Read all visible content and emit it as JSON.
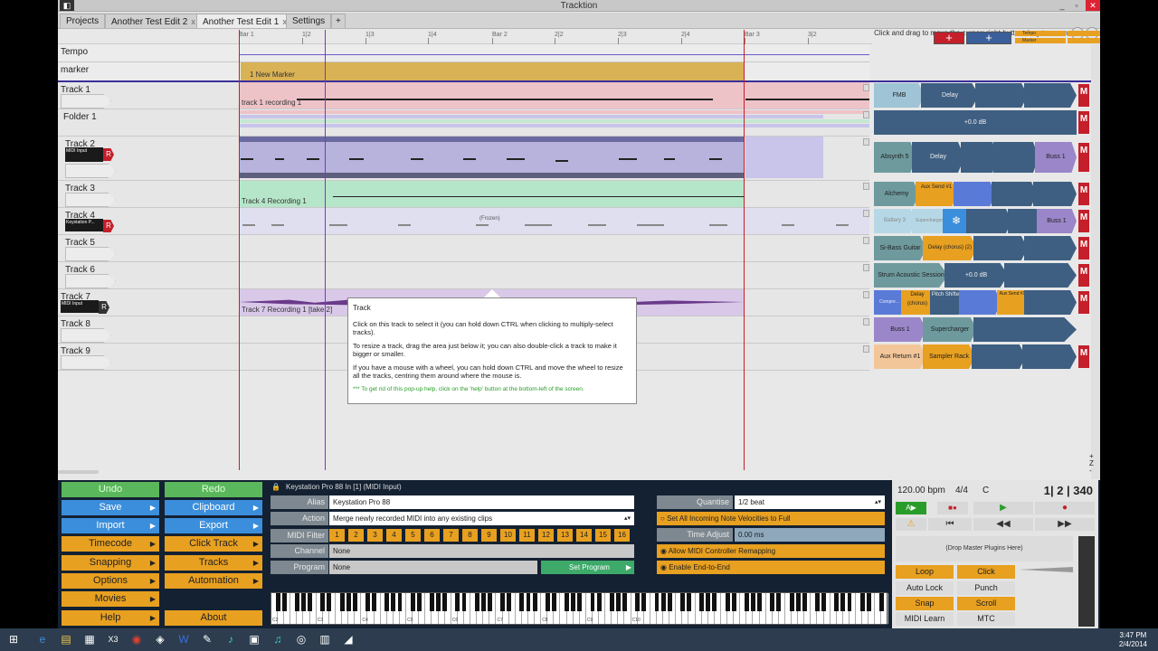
{
  "window": {
    "title": "Tracktion",
    "minimize": "_",
    "maximize": "▫",
    "close": "✕"
  },
  "tabs": [
    {
      "label": "Projects"
    },
    {
      "label": "Another Test Edit 2",
      "close": "x"
    },
    {
      "label": "Another Test Edit 1",
      "close": "x"
    },
    {
      "label": "Settings"
    },
    {
      "label": "+"
    }
  ],
  "hint": "Click and drag to move the cursor; right-button-drag to zoom",
  "ruler": {
    "labels": [
      "Bar 1",
      "1|2",
      "1|3",
      "1|4",
      "Bar 2",
      "2|2",
      "2|3",
      "2|4",
      "Bar 3",
      "3|2"
    ]
  },
  "corner": {
    "add_red": "+",
    "add_blue": "+",
    "tempo_label": "Tempo",
    "marker_label": "Marker"
  },
  "rows": {
    "tempo": "Tempo",
    "marker": "marker",
    "marker_clip": "1 New Marker"
  },
  "tracks": [
    {
      "name": "Track 1",
      "clip": "track 1 recording 1"
    },
    {
      "name": "Folder 1",
      "clip": ""
    },
    {
      "name": "Track 2",
      "midi_in": "MIDI Input",
      "rec": "R"
    },
    {
      "name": "Track 3",
      "clip": "Track 4 Recording 1"
    },
    {
      "name": "Track 4",
      "midi_in": "Keystation P...",
      "rec": "R",
      "clip": "(Frozen)"
    },
    {
      "name": "Track 5"
    },
    {
      "name": "Track 6"
    },
    {
      "name": "Track 7",
      "midi_in": "MIDI Input",
      "rec": "R",
      "clip": "Track 7 Recording 1 [take 2]"
    },
    {
      "name": "Track 8"
    },
    {
      "name": "Track 9"
    }
  ],
  "racks": [
    [
      "FMB",
      "Delay"
    ],
    [
      "+0.0 dB"
    ],
    [
      "Absynth 5",
      "Delay",
      "Buss 1"
    ],
    [
      "Alchemy",
      "Aux Send #1"
    ],
    [
      "Battery 3",
      "Supercharger",
      "Buss 1"
    ],
    [
      "Si-Bass Guitar",
      "Delay (chorus) (2)"
    ],
    [
      "Strum Acoustic Session",
      "+0.0 dB"
    ],
    [
      "Compre...",
      "Delay (chorus)",
      "Pitch Shifter",
      "Aux Send #1"
    ],
    [
      "Buss 1",
      "Supercharger"
    ],
    [
      "Aux Return #1",
      "Sampler Rack"
    ]
  ],
  "m_label": "M",
  "popup": {
    "title": "Track",
    "p1": "Click on this track to select it (you can hold down CTRL when clicking to multiply-select tracks).",
    "p2": "To resize a track, drag the area just below it; you can also double-click a track to make it bigger or smaller.",
    "p3": "If you have a mouse with a wheel, you can hold down CTRL and move the wheel to resize all the tracks, centring them around where the mouse is.",
    "p4": "*** To get rid of this pop-up help, click on the 'help' button at the bottom-left of the screen."
  },
  "left_buttons": [
    "Undo",
    "Save",
    "Import",
    "Timecode",
    "Snapping",
    "Options",
    "Movies",
    "Help"
  ],
  "right_buttons": [
    "Redo",
    "Clipboard",
    "Export",
    "Click Track",
    "Tracks",
    "Automation",
    "About"
  ],
  "props": {
    "header": "Keystation Pro 88 In [1] (MIDI Input)",
    "alias_label": "Alias",
    "alias_value": "Keystation Pro 88",
    "action_label": "Action",
    "action_value": "Merge newly recorded MIDI into any existing clips",
    "filter_label": "MIDI Filter",
    "channels": [
      "1",
      "2",
      "3",
      "4",
      "5",
      "6",
      "7",
      "8",
      "9",
      "10",
      "11",
      "12",
      "13",
      "14",
      "15",
      "16"
    ],
    "channel_label": "Channel",
    "channel_value": "None",
    "program_label": "Program",
    "program_value": "None",
    "set_program": "Set Program"
  },
  "quantise": {
    "label": "Quantise",
    "value": "1/2 beat",
    "velocities": "Set All Incoming Note Velocities to Full",
    "time_label": "Time Adjust",
    "time_value": "0.00 ms",
    "remap": "Allow MIDI Controller Remapping",
    "end_to_end": "Enable End-to-End"
  },
  "keyboard_labels": [
    "C2",
    "C3",
    "C4",
    "C5",
    "C6",
    "C7",
    "C8",
    "C9",
    "C10"
  ],
  "transport": {
    "bpm": "120.00 bpm",
    "sig": "4/4",
    "key": "C",
    "position": "1| 2 | 340",
    "master": "(Drop Master Plugins Here)",
    "play": "▶",
    "rec": "●",
    "rewind": "⏮",
    "back": "◀◀",
    "fwd": "▶▶",
    "warn": "⚠",
    "buttons": [
      "Loop",
      "Click",
      "Auto Lock",
      "Punch",
      "Snap",
      "Scroll",
      "MIDI Learn",
      "MTC"
    ]
  },
  "zoom": {
    "plus": "+",
    "z": "Z",
    "minus": "-"
  },
  "taskbar": {
    "time": "3:47 PM",
    "date": "2/4/2014"
  },
  "colors": {
    "accent_orange": "#e8a020",
    "accent_blue": "#3b8edb",
    "rec_red": "#c41f2a"
  }
}
